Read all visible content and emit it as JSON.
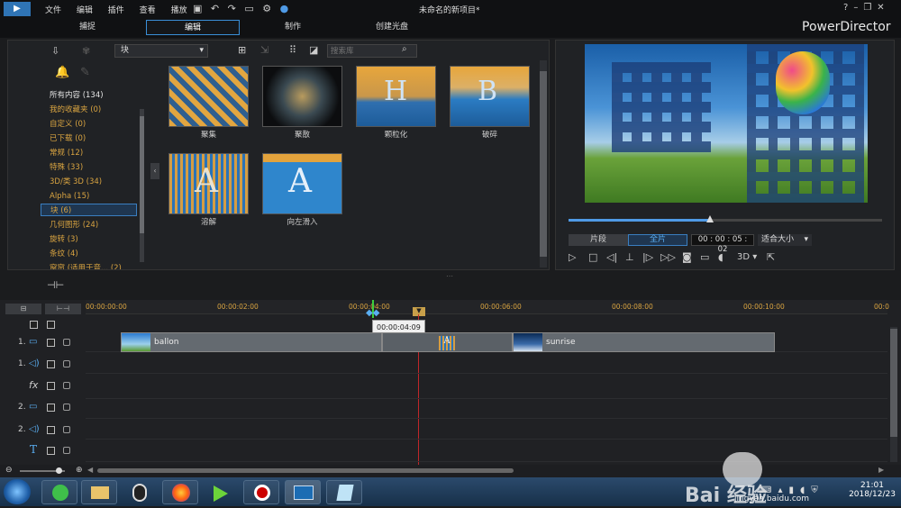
{
  "app": {
    "title": "未命名的新项目*",
    "brand": "PowerDirector",
    "help": "?"
  },
  "menu": [
    "文件",
    "编辑",
    "插件",
    "查看",
    "播放"
  ],
  "tabs": [
    {
      "label": "捕捉"
    },
    {
      "label": "编辑",
      "active": true
    },
    {
      "label": "制作"
    },
    {
      "label": "创建光盘"
    }
  ],
  "library": {
    "dropdown": "块",
    "search_placeholder": "搜索库",
    "categories": [
      {
        "label": "所有内容 (134)",
        "color": "#e6e6e6"
      },
      {
        "label": "我的收藏夹  (0)"
      },
      {
        "label": "自定义  (0)"
      },
      {
        "label": "已下载  (0)"
      },
      {
        "label": "常规  (12)"
      },
      {
        "label": "特殊  (33)"
      },
      {
        "label": "3D/类 3D  (34)"
      },
      {
        "label": "Alpha  (15)"
      },
      {
        "label": "块  (6)",
        "selected": true
      },
      {
        "label": "几何图形  (24)"
      },
      {
        "label": "旋转  (3)"
      },
      {
        "label": "条纹  (4)"
      },
      {
        "label": "窗帘 (适用于音...  (2)"
      }
    ],
    "items": [
      {
        "label": "聚集"
      },
      {
        "label": "聚散"
      },
      {
        "label": "颗粒化"
      },
      {
        "label": "破碎"
      },
      {
        "label": "溶解"
      },
      {
        "label": "向左滑入"
      }
    ]
  },
  "preview": {
    "clip_label": "片段",
    "movie_label": "全片",
    "timecode": "00 : 00 : 05 : 02",
    "fit": "适合大小",
    "mode3d": "3D",
    "progress": 0.45
  },
  "timeline": {
    "ruler": [
      "00:00:00:00",
      "00:00:02:00",
      "00:00:04:00",
      "00:00:06:00",
      "00:00:08:00",
      "00:00:10:00",
      "00:0"
    ],
    "tooltip": "00:00:04:09",
    "tracks": [
      {
        "num": "1.",
        "kind": "video"
      },
      {
        "num": "1.",
        "kind": "audio"
      },
      {
        "num": "",
        "kind": "fx"
      },
      {
        "num": "2.",
        "kind": "video"
      },
      {
        "num": "2.",
        "kind": "audio"
      },
      {
        "num": "",
        "kind": "title"
      }
    ],
    "clips": [
      {
        "name": "ballon"
      },
      {
        "name": "sunrise"
      }
    ]
  },
  "taskbar": {
    "time": "21:01",
    "date": "2018/12/23"
  },
  "watermark": {
    "text": "Bai 经验",
    "url": "jingyan.baidu.com"
  }
}
